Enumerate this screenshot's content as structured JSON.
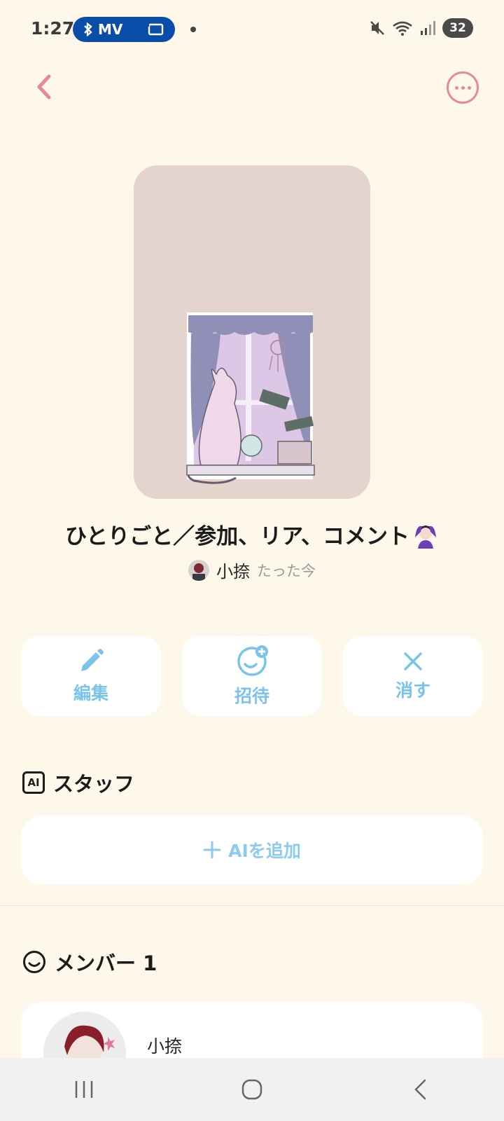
{
  "status_bar": {
    "time": "1:27",
    "pill_label": "MV",
    "battery": "32",
    "icons": [
      "bluetooth-icon",
      "cast-icon",
      "mute-icon",
      "wifi-icon",
      "signal-icon"
    ]
  },
  "topbar": {
    "back_icon": "chevron-left-icon",
    "more_icon": "more-horizontal-icon"
  },
  "post": {
    "title": "ひとりごと／参加、リア、コメント",
    "title_emoji": "person-gesturing-ok-emoji",
    "author": "小捺",
    "time": "たった今"
  },
  "actions": [
    {
      "label": "編集",
      "icon": "pencil-icon"
    },
    {
      "label": "招待",
      "icon": "add-face-icon"
    },
    {
      "label": "消す",
      "icon": "close-icon"
    }
  ],
  "staff_section": {
    "badge": "AI",
    "title": "スタッフ",
    "add_label": "AIを追加"
  },
  "member_section": {
    "title": "メンバー 1",
    "members": [
      {
        "name": "小捺"
      }
    ]
  },
  "colors": {
    "background": "#fdf8ea",
    "accent_pink": "#e58a96",
    "accent_blue": "#7cc3ea",
    "cover_bg": "#e5d3ce"
  }
}
